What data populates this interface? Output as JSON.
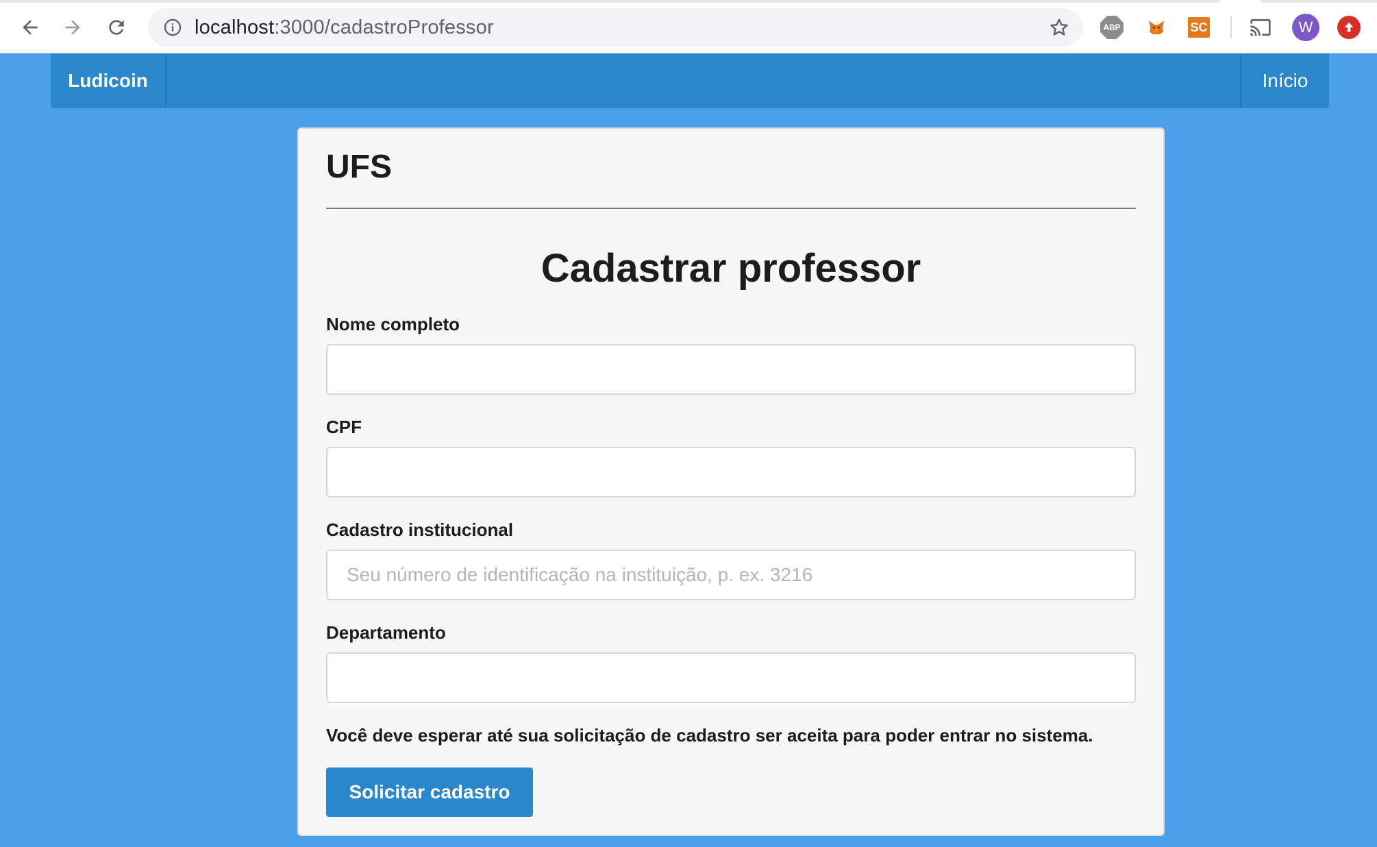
{
  "browser": {
    "url_host": "localhost",
    "url_path": ":3000/cadastroProfessor",
    "extensions": {
      "abp_label": "ABP",
      "sc_label": "SC"
    },
    "profile_initial": "W",
    "icons": {
      "back": "arrow-left-icon",
      "forward": "arrow-right-icon",
      "reload": "reload-icon",
      "info": "info-icon",
      "bookmark": "star-icon",
      "metamask": "fox-icon",
      "cast": "cast-icon",
      "update": "arrow-up-icon"
    }
  },
  "navbar": {
    "brand": "Ludicoin",
    "home_link": "Início",
    "color": "#2a87cc"
  },
  "form": {
    "organization": "UFS",
    "title": "Cadastrar professor",
    "fields": [
      {
        "label": "Nome completo",
        "value": "",
        "placeholder": ""
      },
      {
        "label": "CPF",
        "value": "",
        "placeholder": ""
      },
      {
        "label": "Cadastro institucional",
        "value": "",
        "placeholder": "Seu número de identificação na instituição, p. ex. 3216"
      },
      {
        "label": "Departamento",
        "value": "",
        "placeholder": ""
      }
    ],
    "notice": "Você deve esperar até sua solicitação de cadastro ser aceita para poder entrar no sistema.",
    "submit_label": "Solicitar cadastro"
  },
  "colors": {
    "page_background": "#4ba0e9",
    "accent": "#2a87cc"
  }
}
